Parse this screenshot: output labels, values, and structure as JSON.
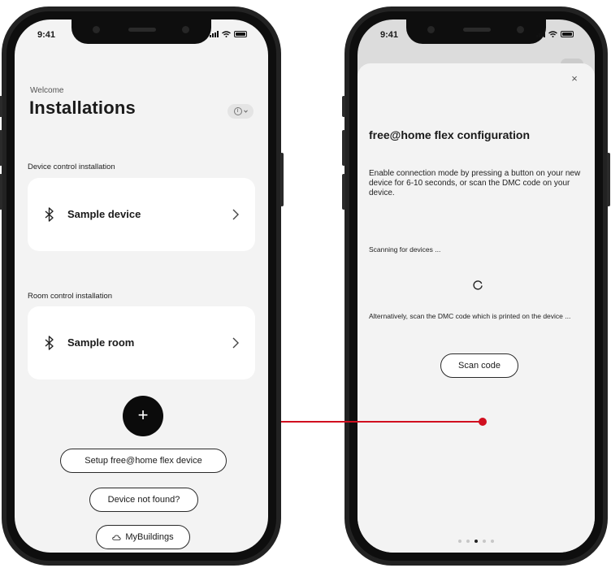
{
  "left_phone": {
    "status_time": "9:41",
    "welcome": "Welcome",
    "title": "Installations",
    "device_section_label": "Device control installation",
    "device_card_label": "Sample device",
    "room_section_label": "Room control installation",
    "room_card_label": "Sample room",
    "add_symbol": "+",
    "setup_button": "Setup free@home flex device",
    "not_found_button": "Device not found?",
    "mybuildings_button": "MyBuildings"
  },
  "right_phone": {
    "status_time": "9:41",
    "close_symbol": "×",
    "title": "free@home flex configuration",
    "description": "Enable connection mode by pressing a button on your new device for 6-10 seconds, or scan the DMC code on your device.",
    "scanning_text": "Scanning for devices ...",
    "alt_text": "Alternatively, scan the DMC code which is printed on the device ...",
    "scan_button": "Scan code",
    "pager": {
      "count": 5,
      "active_index": 2
    }
  },
  "colors": {
    "connector": "#d10f1f",
    "phone_frame": "#222222",
    "screen_bg": "#f3f3f3",
    "card_bg": "#ffffff",
    "fab_bg": "#0b0b0b"
  },
  "icons": {
    "bluetooth": "bluetooth-icon",
    "chevron": "chevron-right-icon",
    "cloud": "cloud-icon",
    "info": "info-icon",
    "close": "close-icon",
    "spinner": "spinner-icon"
  }
}
